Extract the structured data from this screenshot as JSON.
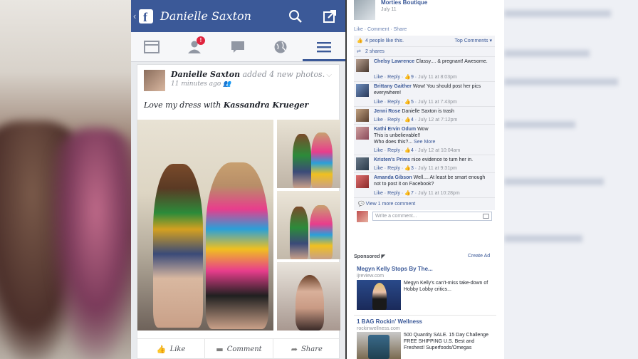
{
  "header": {
    "back": "‹",
    "logo": "f",
    "title": "Danielle Saxton"
  },
  "nav": {
    "notification_count": "!"
  },
  "post": {
    "author": "Danielle Saxton",
    "action": "added 4 new photos.",
    "time": "11 minutes ago",
    "text_prefix": "Love my dress with",
    "tagged": "Kassandra Krueger",
    "actions": [
      "Like",
      "Comment",
      "Share"
    ]
  },
  "comments_panel": {
    "page_name": "Morties Boutique",
    "page_date": "July 11",
    "like_comment_share": "Like · Comment · Share",
    "likes": "4 people like this.",
    "top_comments": "Top Comments ▾",
    "shares": "2 shares",
    "comments": [
      {
        "name": "Chelsy Lawrence",
        "text": "Classy.... & pregnant! Awesome.",
        "likes": "9",
        "date": "July 11 at 8:03pm"
      },
      {
        "name": "Brittany Gaither",
        "text": "Wow! You should post her pics everywhere!",
        "likes": "5",
        "date": "July 11 at 7:43pm"
      },
      {
        "name": "Jenni Rose",
        "text": "Danielle Saxton is trash",
        "likes": "4",
        "date": "July 12 at 7:12pm"
      },
      {
        "name": "Kathi Ervin Odum",
        "text": "Wow\nThis is unbelievable!!\nWho does this?...",
        "see_more": "See More",
        "likes": "4",
        "date": "July 12 at 10:04am"
      },
      {
        "name": "Kristen's Prims",
        "text": "nice evidence to turn her in.",
        "likes": "3",
        "date": "July 11 at 9:31pm"
      },
      {
        "name": "Amanda Gibson",
        "text": "Well.... At least be smart enough not to post it on Facebook?",
        "likes": "7",
        "date": "July 11 at 10:28pm"
      }
    ],
    "like_label": "Like",
    "reply_label": "Reply",
    "view_more": "View 1 more comment",
    "write_placeholder": "Write a comment..."
  },
  "ads": {
    "sponsored": "Sponsored",
    "create_ad": "Create Ad",
    "items": [
      {
        "title": "Megyn Kelly Stops By The...",
        "url": "ijreview.com",
        "desc": "Megyn Kelly's can't-miss take-down of Hobby Lobby critics..."
      },
      {
        "title": "1 BAG Rockin' Wellness",
        "url": "rockinwellness.com",
        "desc": "500 Quantity SALE. 15 Day Challenge FREE SHIPPING U.S. Best and Freshest! Superfoods/Omegas"
      }
    ]
  },
  "colors": {
    "facebook_blue": "#3b5998",
    "link_blue": "#3b5998",
    "badge_red": "#e0243e"
  }
}
